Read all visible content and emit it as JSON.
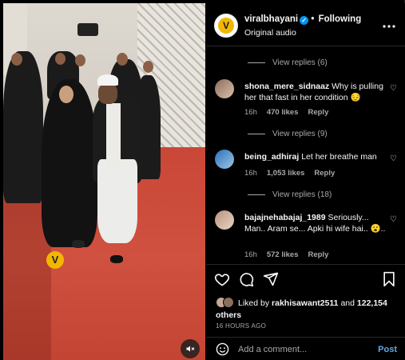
{
  "colors": {
    "accent": "#0095f6",
    "brand": "#f3b600",
    "carpet": "#c94737",
    "muted": "#a8a8a8"
  },
  "video": {
    "mute_icon": "speaker-muted-icon",
    "watermark_icon": "brand-v-logo"
  },
  "header": {
    "username": "viralbhayani",
    "separator": "•",
    "follow_label": "Following",
    "audio": "Original audio",
    "more_icon": "more-horizontal-icon"
  },
  "comments": [
    {
      "type": "replies",
      "label": "View replies (6)"
    },
    {
      "type": "comment",
      "username": "shona_mere_sidnaaz",
      "text": "Why is pulling her that fast in her condition 😔",
      "time": "16h",
      "likes": "470 likes",
      "reply": "Reply"
    },
    {
      "type": "replies",
      "label": "View replies (9)"
    },
    {
      "type": "comment",
      "username": "being_adhiraj",
      "text": "Let her breathe man",
      "time": "16h",
      "likes": "1,053 likes",
      "reply": "Reply"
    },
    {
      "type": "replies",
      "label": "View replies (18)"
    },
    {
      "type": "comment",
      "username": "bajajnehabajaj_1989",
      "text": "Seriously... Man.. Aram se... Apki hi wife hai.. 😮..",
      "time": "16h",
      "likes": "572 likes",
      "reply": "Reply"
    }
  ],
  "actions": {
    "like_icon": "heart-icon",
    "comment_icon": "comment-bubble-icon",
    "share_icon": "paper-plane-icon",
    "save_icon": "bookmark-icon"
  },
  "likes": {
    "prefix": "Liked by",
    "user": "rakhisawant2511",
    "conjunction": "and",
    "count": "122,154",
    "suffix": "others"
  },
  "timestamp": "16 HOURS AGO",
  "add_comment": {
    "placeholder": "Add a comment...",
    "post_label": "Post",
    "emoji_icon": "smiley-icon"
  }
}
